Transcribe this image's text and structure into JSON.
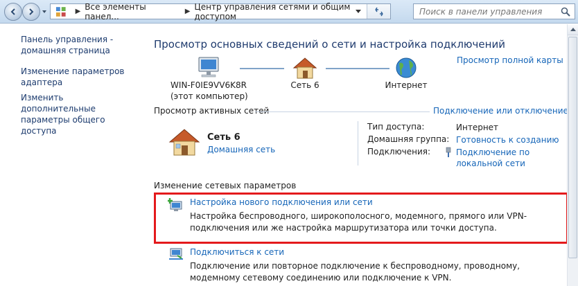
{
  "addressbar": {
    "path": [
      "Все элементы панел...",
      "Центр управления сетями и общим доступом"
    ],
    "search_placeholder": "Поиск в панели управления"
  },
  "sidebar": {
    "items": [
      {
        "label": "Панель управления - домашняя страница"
      },
      {
        "label": "Изменение параметров адаптера"
      },
      {
        "label": "Изменить дополнительные параметры общего доступа"
      }
    ]
  },
  "main": {
    "title": "Просмотр основных сведений о сети и настройка подключений",
    "full_map_link": "Просмотр полной карты",
    "map": {
      "computer_name": "WIN-F0IE9VV6K8R",
      "computer_sub": "(этот компьютер)",
      "network": "Сеть 6",
      "internet": "Интернет"
    },
    "active": {
      "title": "Просмотр активных сетей",
      "connect_link": "Подключение или отключение",
      "network_name": "Сеть 6",
      "network_type": "Домашняя сеть",
      "access_label": "Тип доступа:",
      "access_value": "Интернет",
      "homegroup_label": "Домашняя группа:",
      "homegroup_value": "Готовность к созданию",
      "connections_label": "Подключения:",
      "connections_value_1": "Подключение по",
      "connections_value_2": "локальной сети"
    },
    "change": {
      "title": "Изменение сетевых параметров",
      "tasks": [
        {
          "title": "Настройка нового подключения или сети",
          "desc": "Настройка беспроводного, широкополосного, модемного, прямого или VPN-подключения или же настройка маршрутизатора или точки доступа."
        },
        {
          "title": "Подключиться к сети",
          "desc": "Подключение или повторное подключение к беспроводному, проводному, модемному сетевому соединению или подключение к VPN."
        }
      ]
    }
  },
  "colors": {
    "link": "#1565b8",
    "title": "#1e3a6d",
    "highlight": "#e41a1c"
  }
}
